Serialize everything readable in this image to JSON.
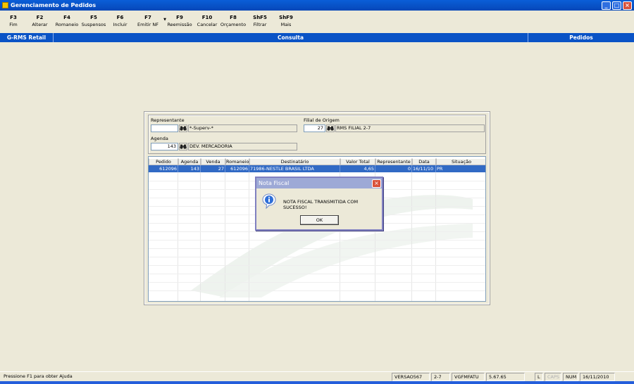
{
  "window": {
    "title": "Gerenciamento de Pedidos"
  },
  "toolbar": [
    {
      "key": "F3",
      "label": "Fim"
    },
    {
      "key": "F2",
      "label": "Alterar"
    },
    {
      "key": "F4",
      "label": "Romaneio"
    },
    {
      "key": "F5",
      "label": "Suspensos"
    },
    {
      "key": "F6",
      "label": "Incluir"
    },
    {
      "key": "F7",
      "label": "Emitir NF"
    },
    {
      "key": "F9",
      "label": "Reemissão"
    },
    {
      "key": "F10",
      "label": "Cancelar"
    },
    {
      "key": "F8",
      "label": "Orçamento"
    },
    {
      "key": "ShF5",
      "label": "Filtrar"
    },
    {
      "key": "ShF9",
      "label": "Mais"
    }
  ],
  "modbar": {
    "left": "G-RMS Retail",
    "center": "Consulta",
    "right": "Pedidos"
  },
  "filter": {
    "representante_label": "Representante",
    "representante_value": "",
    "representante_desc": "*-Superv-*",
    "filial_label": "Filial de Origem",
    "filial_value": "27",
    "filial_desc": "RMS FILIAL 2-7",
    "agenda_label": "Agenda",
    "agenda_value": "143",
    "agenda_desc": "DEV. MERCADORIA"
  },
  "grid": {
    "columns": [
      "Pedido",
      "Agenda",
      "Venda",
      "Romaneio",
      "Destinatário",
      "Valor Total",
      "Representante",
      "Data",
      "Situação"
    ],
    "rows": [
      [
        "612096",
        "143",
        "27",
        "612096",
        "71986-NESTLE BRASIL LTDA",
        "4,65",
        "0",
        "16/11/10",
        "PR"
      ]
    ]
  },
  "msgbox": {
    "title": "Nota Fiscal",
    "message": "NOTA FISCAL TRANSMITIDA COM SUCESSO!",
    "ok": "OK"
  },
  "status": {
    "help": "Pressione F1 para obter Ajuda",
    "version": "VERSAO567",
    "filial": "2-7",
    "program": "VGFMFATU",
    "build": "5.67.65",
    "l": "L",
    "caps": "CAPS",
    "num": "NUM",
    "date": "16/11/2010"
  }
}
